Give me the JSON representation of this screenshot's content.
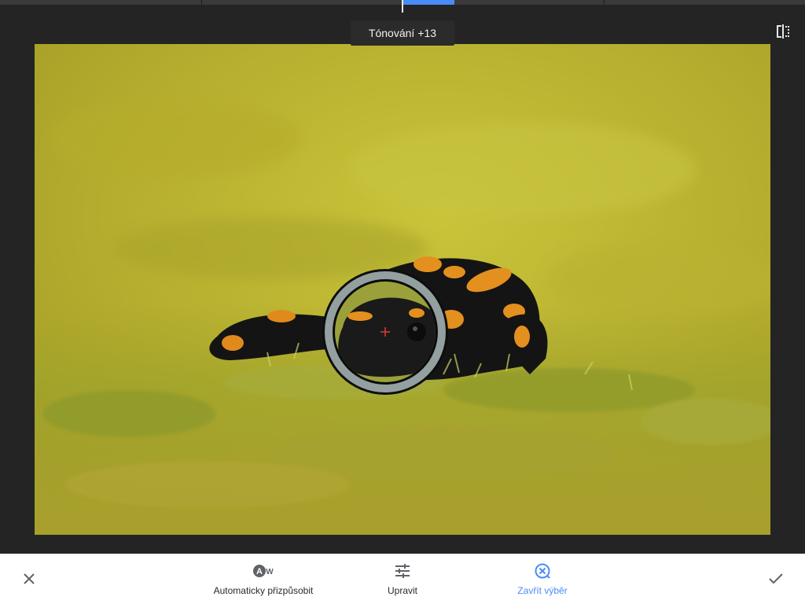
{
  "progress": {
    "fraction": 0.5
  },
  "tooltip": {
    "label": "Tónování",
    "value": "+13"
  },
  "toolbar": {
    "auto_label": "Automaticky přizpůsobit",
    "auto_icon_letter": "A",
    "auto_icon_suffix": "W",
    "adjust_label": "Upravit",
    "close_selection_label": "Zavřít výběr"
  },
  "icons": {
    "compare": "compare-split-icon",
    "cancel": "close-icon",
    "apply": "checkmark-icon",
    "adjust": "sliders-icon",
    "close_selection": "circle-x-icon"
  },
  "colors": {
    "accent": "#4a8cf7",
    "background": "#242424",
    "toolbar": "#ffffff",
    "control_point_marker": "#e53935"
  }
}
